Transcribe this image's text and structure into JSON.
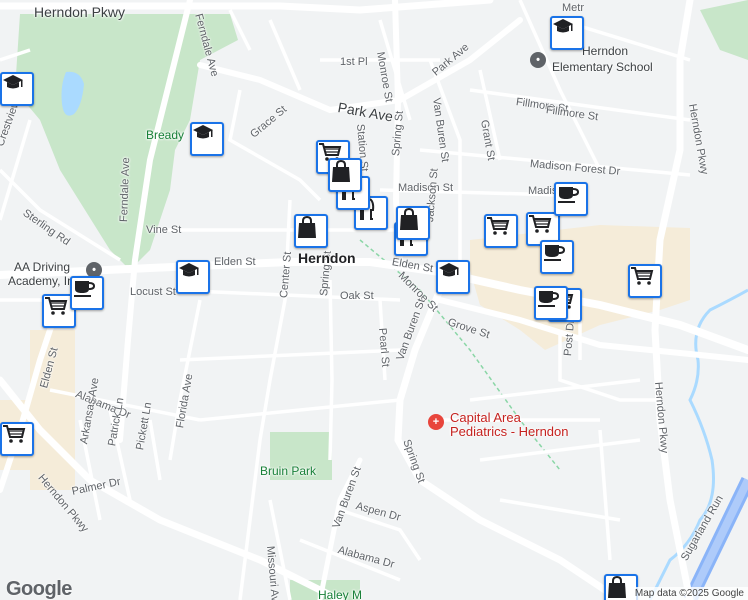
{
  "map": {
    "labels": {
      "herndon_pkwy_top": "Herndon Pkwy",
      "ferndale_ave_top": "Ferndale Ave",
      "park_ave": "Park Ave",
      "park_ave_ne": "Park Ave",
      "first_pl": "1st Pl",
      "monroe_st_n": "Monroe St",
      "van_buren_st_n": "Van Buren St",
      "grant_st": "Grant St",
      "fillmore_st": "Fillmore St",
      "fillmore_st_w": "Fillmore St",
      "madison_forest_dr": "Madison Forest Dr",
      "madison_st": "Madison St",
      "madison_st_e": "Madison St",
      "grace_st": "Grace St",
      "station_st": "Station St",
      "jackson_st": "Jackson St",
      "vine_st": "Vine St",
      "elden_st_center": "Elden St",
      "elden_st_w": "Elden St",
      "locust_st": "Locust St",
      "oak_st": "Oak St",
      "monroe_st_s": "Monroe St",
      "spring_st_n": "Spring St",
      "center_st": "Center St",
      "spring_st_mid": "Spring St",
      "pearl_st": "Pearl St",
      "grove_st": "Grove St",
      "post_dr": "Post Dr",
      "herndon_pkwy_e": "Herndon Pkwy",
      "herndon_pkwy_ne": "Herndon Pkwy",
      "van_buren_st_s": "Van Buren St",
      "spring_st_s": "Spring St",
      "crestview": "Crestview",
      "sterling_rd": "Sterling Rd",
      "ferndale_ave": "Ferndale Ave",
      "alabama_dr_w": "Alabama Dr",
      "arkansas_ave": "Arkansas Ave",
      "patrick_ln": "Patrick Ln",
      "pickett_ln": "Pickett Ln",
      "florida_ave": "Florida Ave",
      "elden_st_sw": "Elden St",
      "herndon_pkwy_sw": "Herndon Pkwy",
      "palmer_dr": "Palmer Dr",
      "missouri_ave": "Missouri Ave",
      "van_buren_st_sw": "Van Buren St",
      "aspen_dr": "Aspen Dr",
      "alabama_dr_s": "Alabama Dr",
      "sugarland_run": "Sugarland Run",
      "metro": "Metr"
    },
    "places": {
      "herndon": "Herndon",
      "bready": "Bready",
      "bruin_park": "Bruin Park",
      "haley": "Haley M",
      "aa_driving_line1": "AA Driving",
      "aa_driving_line2": "Academy, Inc",
      "capital_area_line1": "Capital Area",
      "capital_area_line2": "Pediatrics - Herndon",
      "herndon_elem_line1": "Herndon",
      "herndon_elem_line2": "Elementary School"
    },
    "markers": [
      {
        "id": "school-1",
        "icon": "school-icon"
      },
      {
        "id": "school-2",
        "icon": "school-icon"
      },
      {
        "id": "school-3",
        "icon": "school-icon"
      },
      {
        "id": "school-4",
        "icon": "school-icon"
      },
      {
        "id": "school-5",
        "icon": "school-icon"
      },
      {
        "id": "grocery-1",
        "icon": "shopping-cart-icon"
      },
      {
        "id": "grocery-2",
        "icon": "shopping-cart-icon"
      },
      {
        "id": "grocery-3",
        "icon": "shopping-cart-icon"
      },
      {
        "id": "grocery-4",
        "icon": "shopping-cart-icon"
      },
      {
        "id": "grocery-5",
        "icon": "shopping-cart-icon"
      },
      {
        "id": "grocery-6",
        "icon": "shopping-cart-icon"
      },
      {
        "id": "grocery-7",
        "icon": "shopping-cart-icon"
      },
      {
        "id": "cafe-1",
        "icon": "coffee-cup-icon"
      },
      {
        "id": "cafe-2",
        "icon": "coffee-cup-icon"
      },
      {
        "id": "cafe-3",
        "icon": "coffee-cup-icon"
      },
      {
        "id": "cafe-4",
        "icon": "coffee-cup-icon"
      },
      {
        "id": "restaurant-1",
        "icon": "fork-knife-icon"
      },
      {
        "id": "restaurant-2",
        "icon": "fork-knife-icon"
      },
      {
        "id": "restaurant-3",
        "icon": "fork-knife-icon"
      },
      {
        "id": "shop-1",
        "icon": "shopping-bag-icon"
      },
      {
        "id": "shop-2",
        "icon": "shopping-bag-icon"
      },
      {
        "id": "shop-3",
        "icon": "shopping-bag-icon"
      },
      {
        "id": "shop-4",
        "icon": "shopping-bag-icon"
      }
    ],
    "logo": "Google",
    "attribution": "Map data ©2025 Google",
    "colors": {
      "background": "#f1f3f4",
      "park": "#c8e6c9",
      "water": "#aadaff",
      "commercial": "#f5ecd9",
      "road": "#ffffff",
      "marker_border": "#1a73e8",
      "rail": "#8ad6a6"
    }
  }
}
